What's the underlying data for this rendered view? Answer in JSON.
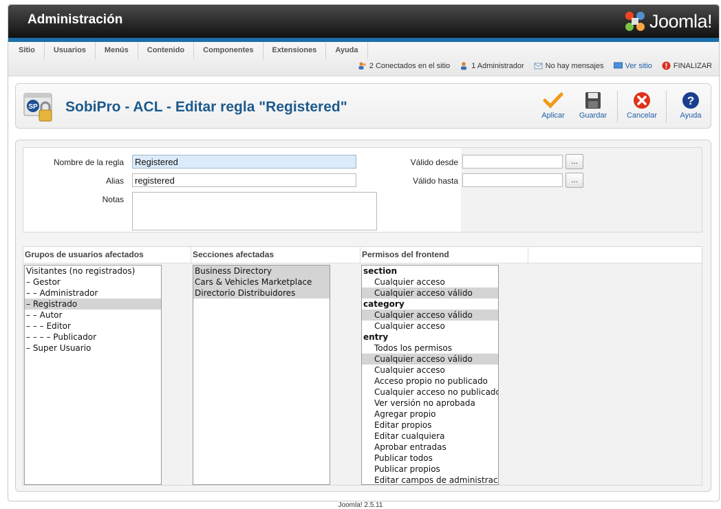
{
  "header": {
    "title": "Administración",
    "logo_text": "Joomla!"
  },
  "menu": [
    "Sitio",
    "Usuarios",
    "Menús",
    "Contenido",
    "Componentes",
    "Extensiones",
    "Ayuda"
  ],
  "status": {
    "online": "2 Conectados en el sitio",
    "admins": "1 Administrador",
    "messages": "No hay mensajes",
    "view_site": "Ver sitio",
    "logout": "FINALIZAR"
  },
  "toolbar": {
    "page_title": "SobiPro - ACL - Editar regla \"Registered\"",
    "apply": "Aplicar",
    "save": "Guardar",
    "cancel": "Cancelar",
    "help": "Ayuda"
  },
  "form": {
    "rule_name_label": "Nombre de la regla",
    "rule_name_value": "Registered",
    "alias_label": "Alias",
    "alias_value": "registered",
    "notes_label": "Notas",
    "valid_from_label": "Válido desde",
    "valid_to_label": "Válido hasta",
    "date_button": "..."
  },
  "columns": {
    "groups_title": "Grupos de usuarios afectados",
    "sections_title": "Secciones afectadas",
    "permissions_title": "Permisos del frontend"
  },
  "groups": [
    {
      "label": "Visitantes (no registrados)",
      "selected": false
    },
    {
      "label": "– Gestor",
      "selected": false
    },
    {
      "label": "– – Administrador",
      "selected": false
    },
    {
      "label": "– Registrado",
      "selected": true
    },
    {
      "label": "– – Autor",
      "selected": false
    },
    {
      "label": "– – – Editor",
      "selected": false
    },
    {
      "label": "– – – – Publicador",
      "selected": false
    },
    {
      "label": "– Super Usuario",
      "selected": false
    }
  ],
  "sections": [
    {
      "label": "Business Directory",
      "selected": true
    },
    {
      "label": "Cars & Vehicles Marketplace",
      "selected": true
    },
    {
      "label": "Directorio Distribuidores",
      "selected": true
    }
  ],
  "permissions": [
    {
      "label": "section",
      "group": true
    },
    {
      "label": "Cualquier acceso",
      "selected": false
    },
    {
      "label": "Cualquier acceso válido",
      "selected": true
    },
    {
      "label": "category",
      "group": true
    },
    {
      "label": "Cualquier acceso válido",
      "selected": true
    },
    {
      "label": "Cualquier acceso",
      "selected": false
    },
    {
      "label": "entry",
      "group": true
    },
    {
      "label": "Todos los permisos",
      "selected": false
    },
    {
      "label": "Cualquier acceso válido",
      "selected": true
    },
    {
      "label": "Cualquier acceso",
      "selected": false
    },
    {
      "label": "Acceso propio no publicado",
      "selected": false
    },
    {
      "label": "Cualquier acceso no publicado",
      "selected": false
    },
    {
      "label": "Ver versión no aprobada",
      "selected": false
    },
    {
      "label": "Agregar propio",
      "selected": false
    },
    {
      "label": "Editar propios",
      "selected": false
    },
    {
      "label": "Editar cualquiera",
      "selected": false
    },
    {
      "label": "Aprobar entradas",
      "selected": false
    },
    {
      "label": "Publicar todos",
      "selected": false
    },
    {
      "label": "Publicar propios",
      "selected": false
    },
    {
      "label": "Editar campos de administración",
      "selected": false
    }
  ],
  "footer": "Joomla! 2.5.11",
  "colors": {
    "title_blue": "#1d5a8c",
    "accent_blue": "#1d6ea8",
    "selection": "#d4d4d4"
  }
}
